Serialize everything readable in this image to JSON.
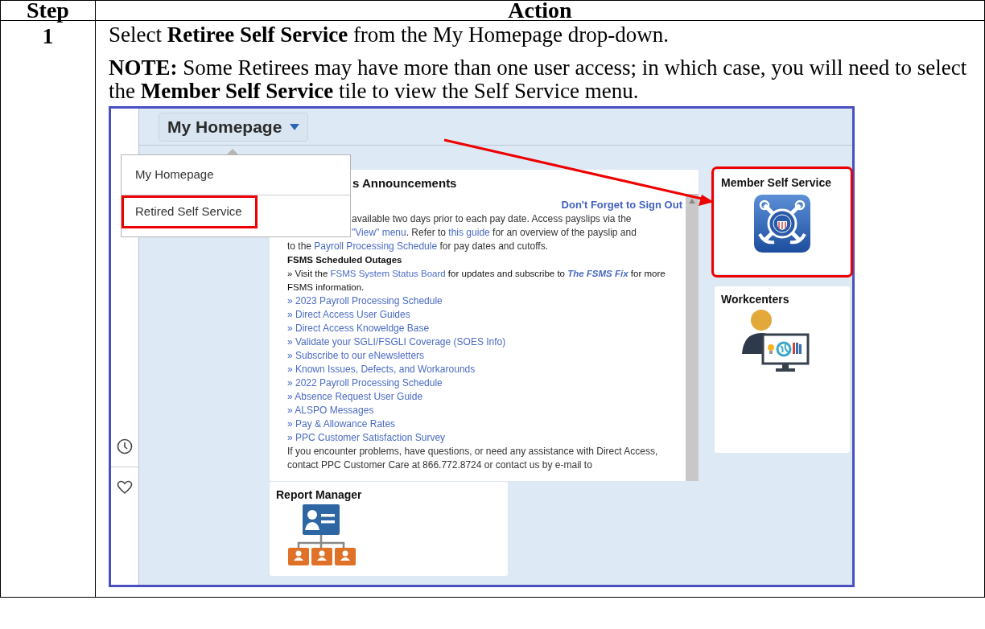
{
  "table": {
    "columns": [
      "Step",
      "Action"
    ],
    "rows": [
      {
        "step": "1",
        "instruction": "Select **Retiree Self Service** from the My Homepage drop-down.",
        "note": "**NOTE:**  Some Retirees may have more than one user access; in which case, you will need to select the **Member Self Service** tile to view the Self Service menu.",
        "screenshot": {
          "homepage_button": {
            "label": "My Homepage"
          },
          "dropdown": {
            "expanded": true,
            "items": [
              {
                "label": "My Homepage",
                "highlighted": false
              },
              {
                "label": "Retired Self Service",
                "highlighted": true
              }
            ]
          },
          "side_icons": [
            {
              "kind": "clock"
            },
            {
              "kind": "heart"
            }
          ],
          "announcements": {
            "title": "s Announcements",
            "sign_out_link": "Don't Forget to Sign Out",
            "blocks": [
              {
                "kind": "clipped_line",
                "segments": [
                  {
                    "kind": "text",
                    "text": "available two days prior to each pay date.  Access payslips via the"
                  }
                ]
              },
              {
                "kind": "clipped_line",
                "segments": [
                  {
                    "kind": "link",
                    "text": "\"View\" menu"
                  },
                  {
                    "kind": "text",
                    "text": ".  Refer to "
                  },
                  {
                    "kind": "link",
                    "text": "this guide"
                  },
                  {
                    "kind": "text",
                    "text": " for an overview of the payslip and"
                  }
                ]
              },
              {
                "kind": "line",
                "segments": [
                  {
                    "kind": "text",
                    "text": "to the "
                  },
                  {
                    "kind": "link",
                    "text": "Payroll Processing Schedule"
                  },
                  {
                    "kind": "text",
                    "text": " for pay dates and cutoffs."
                  }
                ]
              },
              {
                "kind": "heading",
                "segments": [
                  {
                    "kind": "text",
                    "text": "FSMS Scheduled Outages"
                  }
                ]
              },
              {
                "kind": "notice",
                "segments": [
                  {
                    "kind": "text",
                    "text": "» Visit the  "
                  },
                  {
                    "kind": "link",
                    "text": "FSMS System Status Board"
                  },
                  {
                    "kind": "text",
                    "text": " for updates and subscribe to "
                  },
                  {
                    "kind": "italic_link",
                    "text": "The FSMS Fix"
                  },
                  {
                    "kind": "text",
                    "text": " for more FSMS information."
                  }
                ]
              },
              {
                "kind": "link_item",
                "segments": [
                  {
                    "kind": "link",
                    "text": "» 2023 Payroll Processing Schedule"
                  }
                ]
              },
              {
                "kind": "link_item",
                "segments": [
                  {
                    "kind": "link",
                    "text": "» Direct Access User Guides"
                  }
                ]
              },
              {
                "kind": "link_item",
                "segments": [
                  {
                    "kind": "link",
                    "text": "» Direct Access Knoweldge Base"
                  }
                ]
              },
              {
                "kind": "link_item",
                "segments": [
                  {
                    "kind": "link",
                    "text": "» Validate your SGLI/FSGLI Coverage (SOES Info)"
                  }
                ]
              },
              {
                "kind": "link_item",
                "segments": [
                  {
                    "kind": "link",
                    "text": "» Subscribe to our eNewsletters"
                  }
                ]
              },
              {
                "kind": "link_item",
                "segments": [
                  {
                    "kind": "link",
                    "text": "» Known Issues, Defects, and Workarounds"
                  }
                ]
              },
              {
                "kind": "link_item",
                "segments": [
                  {
                    "kind": "link",
                    "text": "» 2022 Payroll Processing Schedule"
                  }
                ]
              },
              {
                "kind": "link_item",
                "segments": [
                  {
                    "kind": "link",
                    "text": "» Absence Request User Guide"
                  }
                ]
              },
              {
                "kind": "link_item",
                "segments": [
                  {
                    "kind": "link",
                    "text": "» ALSPO Messages"
                  }
                ]
              },
              {
                "kind": "link_item",
                "segments": [
                  {
                    "kind": "link",
                    "text": "» Pay & Allowance Rates"
                  }
                ]
              },
              {
                "kind": "link_item",
                "segments": [
                  {
                    "kind": "link",
                    "text": "» PPC Customer Satisfaction Survey"
                  }
                ]
              },
              {
                "kind": "line",
                "segments": [
                  {
                    "kind": "text",
                    "text": "If you encounter problems, have questions, or need any assistance with Direct Access, contact PPC Customer Care at 866.772.8724 or contact us by e-mail to"
                  }
                ]
              }
            ]
          },
          "tiles": [
            {
              "title": "Member Self Service",
              "kind": "seal",
              "highlighted": true
            },
            {
              "title": "Workcenters",
              "kind": "workcenter",
              "highlighted": false
            },
            {
              "title": "Report Manager",
              "kind": "org",
              "highlighted": false
            }
          ]
        }
      }
    ]
  }
}
